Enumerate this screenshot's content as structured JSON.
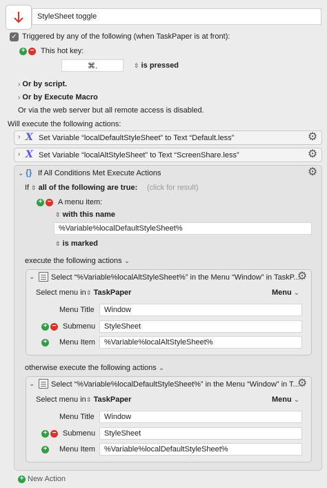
{
  "macro": {
    "name": "StyleSheet toggle",
    "icon": "arrow-down-icon",
    "icon_color": "#d9342b"
  },
  "trigger": {
    "label": "Triggered by any of the following (when TaskPaper is at front):",
    "hotkey_label": "This hot key:",
    "hotkey_value": "⌘.",
    "hotkey_state": "is pressed",
    "or_script": "Or by script.",
    "or_execute_macro": "Or by Execute Macro",
    "web_server": "Or via the web server but all remote access is disabled."
  },
  "actions_label": "Will execute the following actions:",
  "actions": [
    {
      "text": "Set Variable “localDefaultStyleSheet” to Text “Default.less”"
    },
    {
      "text": "Set Variable “localAltStyleSheet” to Text “ScreenShare.less”"
    }
  ],
  "if_action": {
    "title": "If All Conditions Met Execute Actions",
    "if_label": "If",
    "all_of": "all of the following are true:",
    "click_result": "(click for result)",
    "menu_item_label": "A menu item:",
    "with_name": "with this name",
    "name_value": "%Variable%localDefaultStyleSheet%",
    "is_marked": "is marked",
    "execute_label": "execute the following actions",
    "otherwise_label": "otherwise execute the following actions"
  },
  "select_then": {
    "title": "Select “%Variable%localAltStyleSheet%” in the Menu “Window” in TaskP...",
    "select_menu_in": "Select menu in",
    "app": "TaskPaper",
    "menu_btn": "Menu",
    "menu_title_label": "Menu Title",
    "menu_title_value": "Window",
    "submenu_label": "Submenu",
    "submenu_value": "StyleSheet",
    "menu_item_label": "Menu Item",
    "menu_item_value": "%Variable%localAltStyleSheet%"
  },
  "select_else": {
    "title": "Select “%Variable%localDefaultStyleSheet%” in the Menu “Window” in T...",
    "select_menu_in": "Select menu in",
    "app": "TaskPaper",
    "menu_btn": "Menu",
    "menu_title_label": "Menu Title",
    "menu_title_value": "Window",
    "submenu_label": "Submenu",
    "submenu_value": "StyleSheet",
    "menu_item_label": "Menu Item",
    "menu_item_value": "%Variable%localDefaultStyleSheet%"
  },
  "new_action": "New Action"
}
